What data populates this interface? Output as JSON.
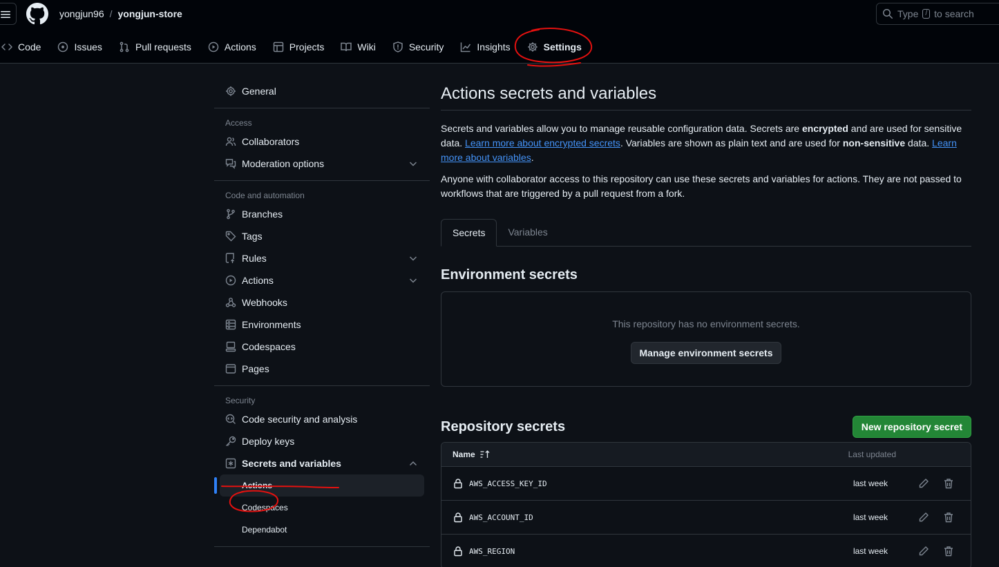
{
  "header": {
    "owner": "yongjun96",
    "separator": "/",
    "repo": "yongjun-store",
    "search_prefix": "Type",
    "search_key": "/",
    "search_suffix": "to search"
  },
  "repo_tabs": [
    {
      "label": "Code",
      "icon": "code-icon"
    },
    {
      "label": "Issues",
      "icon": "issue-icon"
    },
    {
      "label": "Pull requests",
      "icon": "pull-request-icon"
    },
    {
      "label": "Actions",
      "icon": "play-icon"
    },
    {
      "label": "Projects",
      "icon": "table-icon"
    },
    {
      "label": "Wiki",
      "icon": "book-icon"
    },
    {
      "label": "Security",
      "icon": "shield-icon"
    },
    {
      "label": "Insights",
      "icon": "graph-icon"
    },
    {
      "label": "Settings",
      "icon": "gear-icon",
      "active": true
    }
  ],
  "sidebar": {
    "general": "General",
    "access_heading": "Access",
    "collaborators": "Collaborators",
    "moderation": "Moderation options",
    "code_heading": "Code and automation",
    "branches": "Branches",
    "tags": "Tags",
    "rules": "Rules",
    "actions": "Actions",
    "webhooks": "Webhooks",
    "environments": "Environments",
    "codespaces": "Codespaces",
    "pages": "Pages",
    "security_heading": "Security",
    "code_security": "Code security and analysis",
    "deploy_keys": "Deploy keys",
    "secrets": "Secrets and variables",
    "sub_actions": "Actions",
    "sub_codespaces": "Codespaces",
    "sub_dependabot": "Dependabot"
  },
  "main": {
    "title": "Actions secrets and variables",
    "intro_1": "Secrets and variables allow you to manage reusable configuration data. Secrets are ",
    "intro_bold_1": "encrypted",
    "intro_2": " and are used for sensitive data. ",
    "intro_link_1": "Learn more about encrypted secrets",
    "intro_3": ". Variables are shown as plain text and are used for ",
    "intro_bold_2": "non-sensitive",
    "intro_4": " data. ",
    "intro_link_2": "Learn more about variables",
    "intro_5": ".",
    "access_note": "Anyone with collaborator access to this repository can use these secrets and variables for actions. They are not passed to workflows that are triggered by a pull request from a fork.",
    "tabs": [
      "Secrets",
      "Variables"
    ],
    "env_title": "Environment secrets",
    "env_empty": "This repository has no environment secrets.",
    "env_button": "Manage environment secrets",
    "repo_title": "Repository secrets",
    "new_button": "New repository secret",
    "col_name": "Name",
    "col_updated": "Last updated",
    "secrets": [
      {
        "name": "AWS_ACCESS_KEY_ID",
        "updated": "last week"
      },
      {
        "name": "AWS_ACCOUNT_ID",
        "updated": "last week"
      },
      {
        "name": "AWS_REGION",
        "updated": "last week"
      }
    ]
  },
  "colors": {
    "background": "#0d1117",
    "header": "#010409",
    "border": "#30363d",
    "link": "#4493f8",
    "primary_button": "#238636",
    "annotation": "#e5110f"
  }
}
